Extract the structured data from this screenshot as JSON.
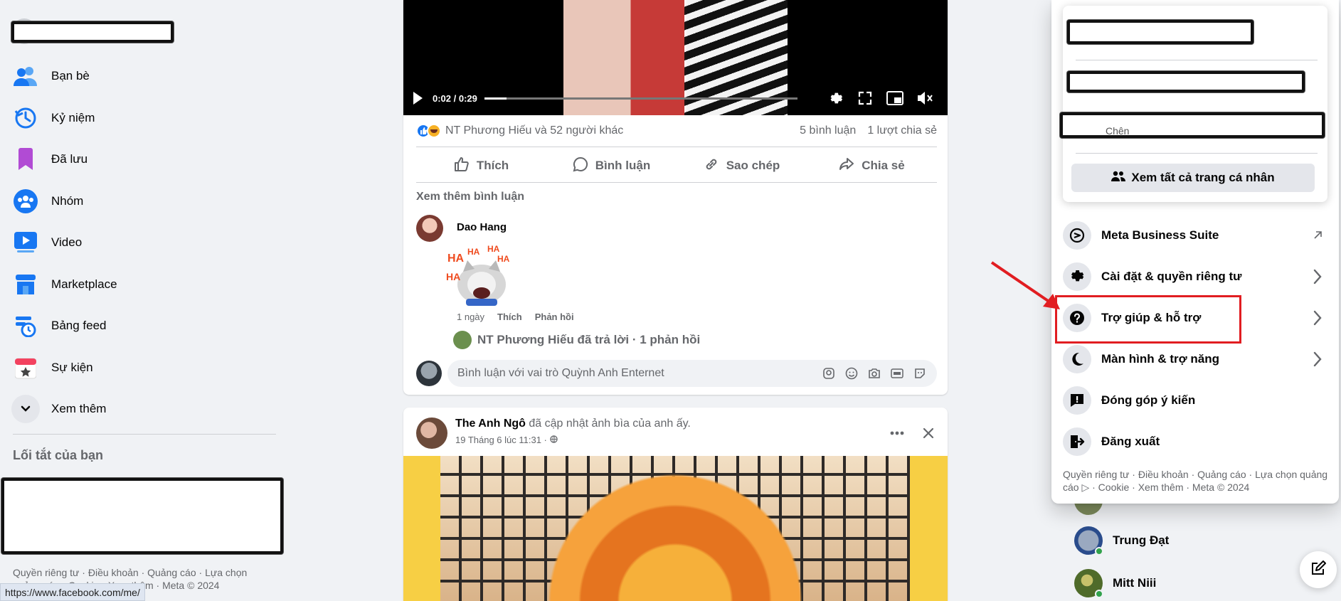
{
  "sidebar": {
    "items": [
      {
        "label": "Bạn bè",
        "icon": "friends-icon"
      },
      {
        "label": "Kỷ niệm",
        "icon": "memories-clock-icon"
      },
      {
        "label": "Đã lưu",
        "icon": "saved-bookmark-icon"
      },
      {
        "label": "Nhóm",
        "icon": "groups-icon"
      },
      {
        "label": "Video",
        "icon": "video-icon"
      },
      {
        "label": "Marketplace",
        "icon": "marketplace-store-icon"
      },
      {
        "label": "Bảng feed",
        "icon": "feeds-icon"
      },
      {
        "label": "Sự kiện",
        "icon": "events-calendar-icon"
      },
      {
        "label": "Xem thêm",
        "icon": "chevron-down-icon"
      }
    ],
    "shortcuts_title": "Lối tắt của bạn",
    "footer": "Quyền riêng tư · Điều khoản · Quảng cáo · Lựa chọn quảng cáo · Cookie · Xem thêm · Meta © 2024"
  },
  "status_url": "https://www.facebook.com/me/",
  "post1": {
    "video": {
      "time": "0:02 / 0:29",
      "progress": 0.07
    },
    "reactions_text": "NT Phương Hiếu và 52 người khác",
    "comments_count": "5 bình luận",
    "shares_count": "1 lượt chia sẻ",
    "actions": {
      "like": "Thích",
      "comment": "Bình luận",
      "copy": "Sao chép",
      "share": "Chia sẻ"
    },
    "more_comments": "Xem thêm bình luận",
    "comment": {
      "author": "Dao Hang",
      "sticker_text": "HA",
      "age": "1 ngày",
      "like": "Thích",
      "reply": "Phản hồi"
    },
    "reply_summary": "NT Phương Hiếu đã trả lời · 1 phản hồi",
    "comment_placeholder": "Bình luận với vai trò Quỳnh Anh Enternet"
  },
  "post2": {
    "author": "The Anh Ngô",
    "action": "đã cập nhật ảnh bìa của anh ấy.",
    "time": "19 Tháng 6 lúc 11:31 ·"
  },
  "menu": {
    "profiles_partial_text": "Chên",
    "see_all_profiles": "Xem tất cả trang cá nhân",
    "items": [
      {
        "label": "Meta Business Suite",
        "icon": "meta-business-suite-icon",
        "right": "external-arrow-icon"
      },
      {
        "label": "Cài đặt & quyền riêng tư",
        "icon": "gear-icon",
        "right": "chevron-right-icon"
      },
      {
        "label": "Trợ giúp & hỗ trợ",
        "icon": "help-question-icon",
        "right": "chevron-right-icon"
      },
      {
        "label": "Màn hình & trợ năng",
        "icon": "moon-icon",
        "right": "chevron-right-icon"
      },
      {
        "label": "Đóng góp ý kiến",
        "icon": "feedback-icon",
        "right": ""
      },
      {
        "label": "Đăng xuất",
        "icon": "logout-icon",
        "right": ""
      }
    ],
    "footer": "Quyền riêng tư · Điều khoản · Quảng cáo · Lựa chọn quảng cáo ▷ · Cookie · Xem thêm · Meta © 2024"
  },
  "contacts": [
    {
      "name": "Trung Đạt"
    },
    {
      "name": "Mitt Niii"
    }
  ],
  "colors": {
    "accent": "#1877f2",
    "highlight": "#e11d21",
    "arrow": "#e11d21",
    "online": "#31a24c"
  }
}
